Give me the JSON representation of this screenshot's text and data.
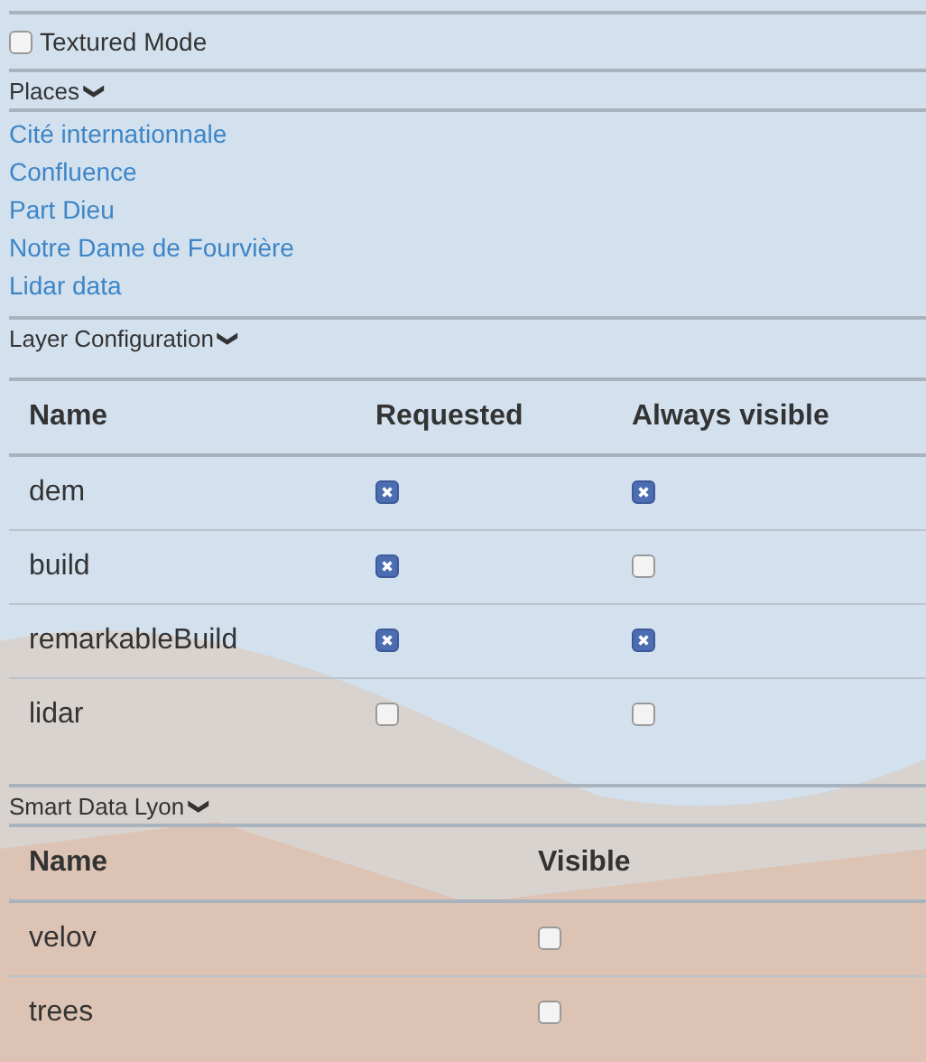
{
  "textured_mode": {
    "label": "Textured Mode",
    "checked": false
  },
  "places": {
    "heading": "Places",
    "chevron": "❯",
    "links": [
      "Cité internationnale",
      "Confluence",
      "Part Dieu",
      "Notre Dame de Fourvière",
      "Lidar data"
    ]
  },
  "layer_configuration": {
    "heading": "Layer Configuration",
    "chevron": "❯",
    "columns": [
      "Name",
      "Requested",
      "Always visible"
    ],
    "rows": [
      {
        "name": "dem",
        "requested": true,
        "always_visible": true
      },
      {
        "name": "build",
        "requested": true,
        "always_visible": false
      },
      {
        "name": "remarkableBuild",
        "requested": true,
        "always_visible": true
      },
      {
        "name": "lidar",
        "requested": false,
        "always_visible": false
      }
    ]
  },
  "smart_data_lyon": {
    "heading": "Smart Data Lyon",
    "chevron": "❯",
    "columns": [
      "Name",
      "Visible"
    ],
    "rows": [
      {
        "name": "velov",
        "visible": false
      },
      {
        "name": "trees",
        "visible": false
      }
    ]
  }
}
